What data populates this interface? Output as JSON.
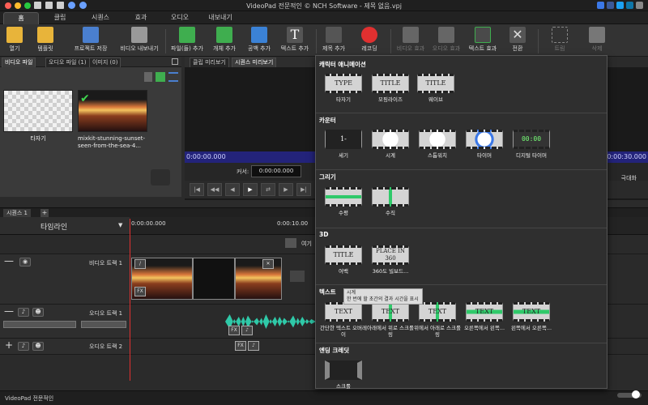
{
  "window": {
    "title": "VideoPad 전문적인 © NCH Software - 제목 없음.vpj"
  },
  "tabs": [
    "홈",
    "클립",
    "시퀀스",
    "효과",
    "오디오",
    "내보내기"
  ],
  "toolbar": {
    "buttons": [
      {
        "label": "열기",
        "icon": "folder-icon"
      },
      {
        "label": "템플릿",
        "icon": "template-icon"
      },
      {
        "label": "프로젝트 저장",
        "icon": "save-icon"
      },
      {
        "label": "비디오 내보내기",
        "icon": "export-video-icon"
      },
      {
        "label": "파일(들) 추가",
        "icon": "add-file-icon"
      },
      {
        "label": "개체 추가",
        "icon": "add-object-icon"
      },
      {
        "label": "공백 추가",
        "icon": "add-blank-icon"
      },
      {
        "label": "텍스트 추가",
        "icon": "add-text-icon"
      },
      {
        "label": "제목 추가",
        "icon": "add-title-icon"
      },
      {
        "label": "레코딩",
        "icon": "record-icon"
      },
      {
        "label": "비디오 효과",
        "icon": "video-effect-icon"
      },
      {
        "label": "오디오 효과",
        "icon": "audio-effect-icon"
      },
      {
        "label": "텍스트 효과",
        "icon": "text-effect-icon"
      },
      {
        "label": "전환",
        "icon": "transition-icon"
      },
      {
        "label": "트림",
        "icon": "trim-icon"
      },
      {
        "label": "삭제",
        "icon": "trash-icon"
      }
    ]
  },
  "media": {
    "tabs": [
      "비디오 파일",
      "오디오 파일 (1)",
      "이미지 (0)"
    ],
    "items": [
      {
        "name": "타자기"
      },
      {
        "name": "mixkit-stunning-sunset-seen-from-the-sea-4..."
      }
    ]
  },
  "preview": {
    "tabs": [
      "클립 미리보기",
      "시퀀스 미리보기"
    ],
    "start_time": "0:00:00.000",
    "end_time": "0:00:30.000",
    "cursor_label": "커서:",
    "cursor_value": "0:00:00.000",
    "fullscreen_label": "극대화"
  },
  "timeline": {
    "sequence_tab": "시퀀스 1",
    "title": "타임라인",
    "ruler": [
      "0:00:00.000",
      "0:00:10.00"
    ],
    "overlay_hint": "여기",
    "tracks": [
      {
        "name": "비디오 트랙 1",
        "type": "video"
      },
      {
        "name": "오디오 트랙 1",
        "type": "audio"
      },
      {
        "name": "오디오 트랙 2",
        "type": "audio"
      }
    ]
  },
  "status_bar": "VideoPad 전문적인",
  "effects_menu": {
    "sections": [
      {
        "title": "캐릭터 애니메이션",
        "items": [
          {
            "label": "타자기",
            "thumb": "TYPE"
          },
          {
            "label": "모핑라이즈",
            "thumb": "TITLE"
          },
          {
            "label": "웨이브",
            "thumb": "TITLE"
          }
        ]
      },
      {
        "title": "카운터",
        "items": [
          {
            "label": "세기",
            "thumb": "1-"
          },
          {
            "label": "시계",
            "thumb": ""
          },
          {
            "label": "스톱워치",
            "thumb": ""
          },
          {
            "label": "타이머",
            "thumb": ""
          },
          {
            "label": "디지털 타이머",
            "thumb": "00:00"
          }
        ]
      },
      {
        "title": "그리기",
        "items": [
          {
            "label": "수평",
            "thumb": ""
          },
          {
            "label": "수직",
            "thumb": ""
          }
        ]
      },
      {
        "title": "3D",
        "items": [
          {
            "label": "여백",
            "thumb": "TITLE"
          },
          {
            "label": "360도 빌보드...",
            "thumb": "PLACE IN 360"
          }
        ]
      },
      {
        "title": "텍스트",
        "items": [
          {
            "label": "간단한 텍스트 오버레이",
            "thumb": "TEXT"
          },
          {
            "label": "아래에서 위로 스크롤링",
            "thumb": "TEXT"
          },
          {
            "label": "위에서 아래로 스크롤링",
            "thumb": "TEXT"
          },
          {
            "label": "오른쪽에서 왼쪽...",
            "thumb": "TEXT"
          },
          {
            "label": "왼쪽에서 오른쪽...",
            "thumb": "TEXT"
          }
        ]
      },
      {
        "title": "엔딩 크레딧",
        "items": [
          {
            "label": "스크롤",
            "thumb": ""
          }
        ]
      }
    ],
    "tooltip": {
      "title": "시계",
      "body": "한 번에 할 초간의 결과 시간을 표시"
    }
  },
  "colors": {
    "background": "#2b2b2b",
    "accent_blue": "#23237a",
    "playhead": "#e03030",
    "audio_wave": "#2fc9a8"
  }
}
